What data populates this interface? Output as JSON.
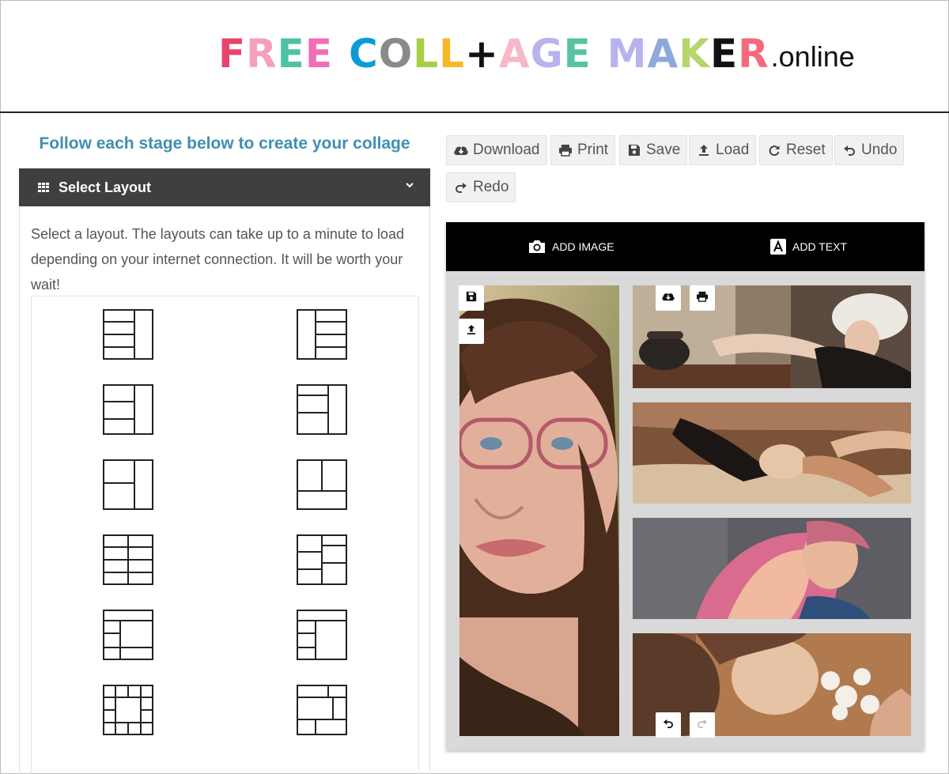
{
  "logo": {
    "letters": [
      {
        "ch": "F",
        "color": "#e8436b"
      },
      {
        "ch": "R",
        "color": "#f59fbf"
      },
      {
        "ch": "E",
        "color": "#4fc2a6"
      },
      {
        "ch": "E",
        "color": "#f06fb6"
      },
      {
        "ch": "C",
        "color": "#0a9bd8"
      },
      {
        "ch": "O",
        "color": "#8a8a8a"
      },
      {
        "ch": "L",
        "color": "#a7cf43"
      },
      {
        "ch": "L",
        "color": "#f5b826"
      },
      {
        "ch": "+",
        "color": "#111111"
      },
      {
        "ch": "A",
        "color": "#f8b7c7"
      },
      {
        "ch": "G",
        "color": "#b7b3ee"
      },
      {
        "ch": "E",
        "color": "#57c3a4"
      },
      {
        "ch": "M",
        "color": "#b7b3ee"
      },
      {
        "ch": "A",
        "color": "#8fa9dc"
      },
      {
        "ch": "K",
        "color": "#b8d46e"
      },
      {
        "ch": "E",
        "color": "#111111"
      },
      {
        "ch": "R",
        "color": "#f46a7b"
      }
    ],
    "word_breaks": [
      4,
      12
    ],
    "suffix": ".online"
  },
  "stage_title": "Follow each stage below to create your collage",
  "layout_section": {
    "title": "Select Layout",
    "instructions": "Select a layout. The layouts can take up to a minute to load depending on your internet connection. It will be worth your wait!"
  },
  "toolbar": {
    "download": "Download",
    "print": "Print",
    "save": "Save",
    "load": "Load",
    "reset": "Reset",
    "undo": "Undo",
    "redo": "Redo"
  },
  "canvas": {
    "add_image": "ADD IMAGE",
    "add_text": "ADD TEXT",
    "photos": [
      {
        "name": "photo-woman-glasses",
        "palette": [
          "#c9a77b",
          "#8a5a3a",
          "#d8a58e",
          "#3a2418"
        ]
      },
      {
        "name": "photo-woman-telephone",
        "palette": [
          "#7c6a5a",
          "#c9b7a3",
          "#2a2422",
          "#a38770"
        ]
      },
      {
        "name": "photo-woman-lying",
        "palette": [
          "#6a4a34",
          "#c8a27e",
          "#1e1614",
          "#e7c6a8"
        ]
      },
      {
        "name": "photo-woman-pink-hair",
        "palette": [
          "#5e5d63",
          "#d96b8e",
          "#e8b79a",
          "#2f4e7a"
        ]
      },
      {
        "name": "photo-woman-flowers",
        "palette": [
          "#b07a4e",
          "#e6c3a4",
          "#f4efe8",
          "#5a3a28"
        ]
      }
    ]
  },
  "icons": {
    "download": "cloud-download-icon",
    "print": "print-icon",
    "save": "floppy-disk-icon",
    "load": "upload-icon",
    "reset": "refresh-icon",
    "undo": "undo-icon",
    "redo": "redo-icon",
    "add_image": "camera-icon",
    "add_text": "text-a-icon",
    "layout": "grid-icon"
  }
}
